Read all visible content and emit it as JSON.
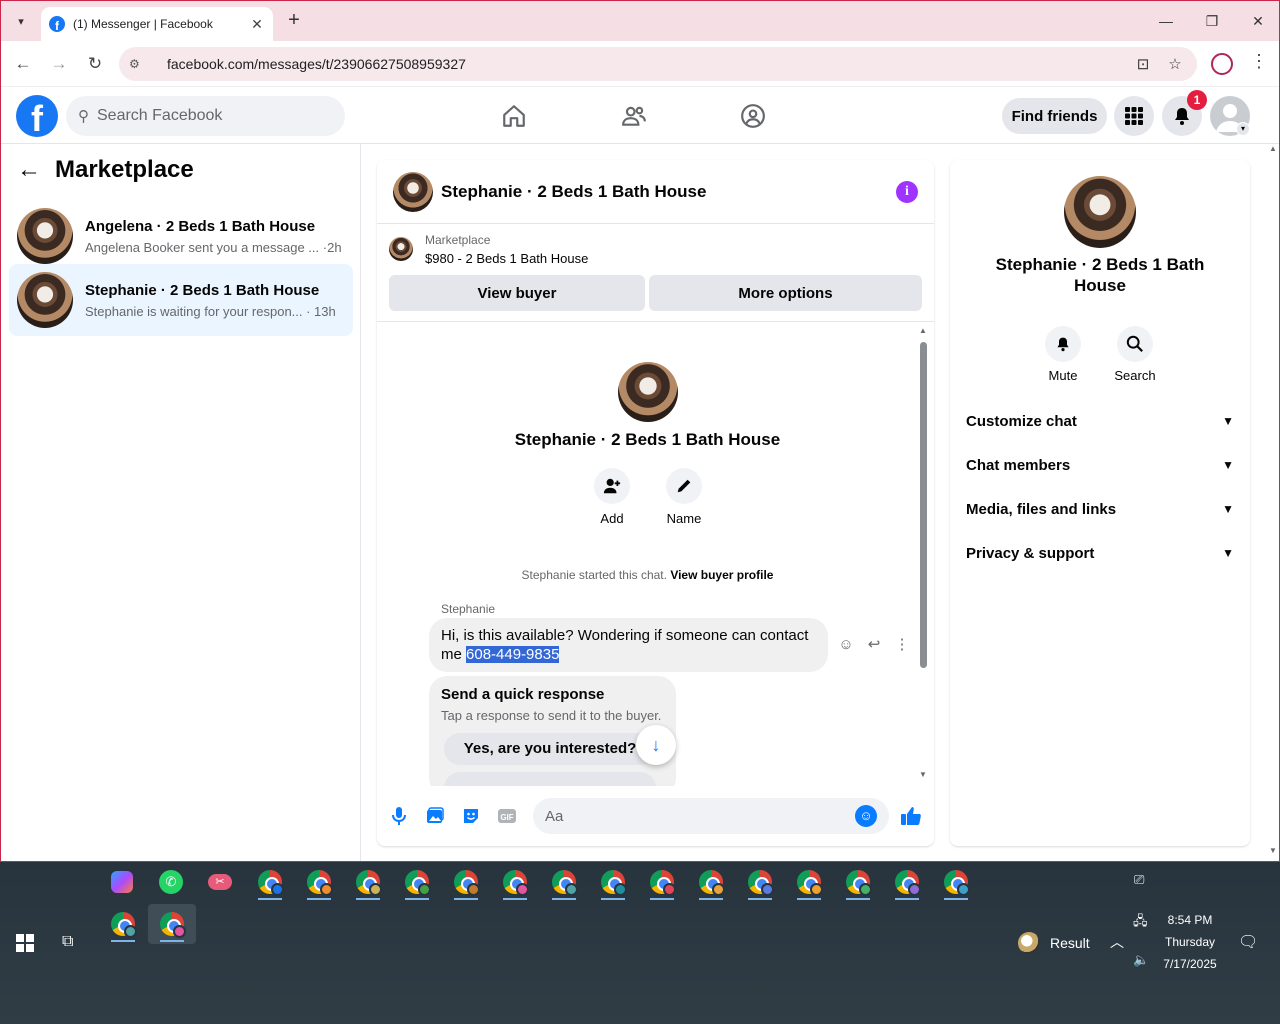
{
  "browser": {
    "tab_title": "(1) Messenger | Facebook",
    "url": "facebook.com/messages/t/23906627508959327"
  },
  "fb": {
    "search_placeholder": "Search Facebook",
    "find_friends": "Find friends",
    "notification_count": "1"
  },
  "sidebar": {
    "title": "Marketplace",
    "conversations": [
      {
        "name": "Angelena · 2 Beds 1 Bath House",
        "preview": "Angelena Booker sent you a message ... ·2h",
        "active": false
      },
      {
        "name": "Stephanie · 2 Beds 1 Bath House",
        "preview": "Stephanie is waiting for your respon... · 13h",
        "active": true
      }
    ]
  },
  "chat": {
    "title": "Stephanie · 2 Beds 1 Bath House",
    "listing_label": "Marketplace",
    "listing_title": "$980 - 2 Beds 1 Bath House",
    "view_buyer": "View buyer",
    "more_options": "More options",
    "profile_name": "Stephanie · 2 Beds 1 Bath House",
    "add_label": "Add",
    "name_label": "Name",
    "started_text": "Stephanie started this chat.",
    "view_buyer_profile": "View buyer profile",
    "sender": "Stephanie",
    "message_text": "Hi, is this available? Wondering if someone can contact me",
    "message_phone": "608-449-9835",
    "quick_title": "Send a quick response",
    "quick_sub": "Tap a response to send it to the buyer.",
    "quick_option": "Yes, are you interested?",
    "composer_placeholder": "Aa"
  },
  "details": {
    "name": "Stephanie · 2 Beds 1 Bath House",
    "mute": "Mute",
    "search": "Search",
    "sections": [
      "Customize chat",
      "Chat members",
      "Media, files and links",
      "Privacy & support"
    ]
  },
  "taskbar": {
    "weather": "Result",
    "time": "8:54 PM",
    "day": "Thursday",
    "date": "7/17/2025"
  },
  "colors": {
    "fb_blue": "#1877f2",
    "messenger_accent": "#0a7cff",
    "info_purple": "#a033ff",
    "active_conv_bg": "#ebf5ff"
  }
}
